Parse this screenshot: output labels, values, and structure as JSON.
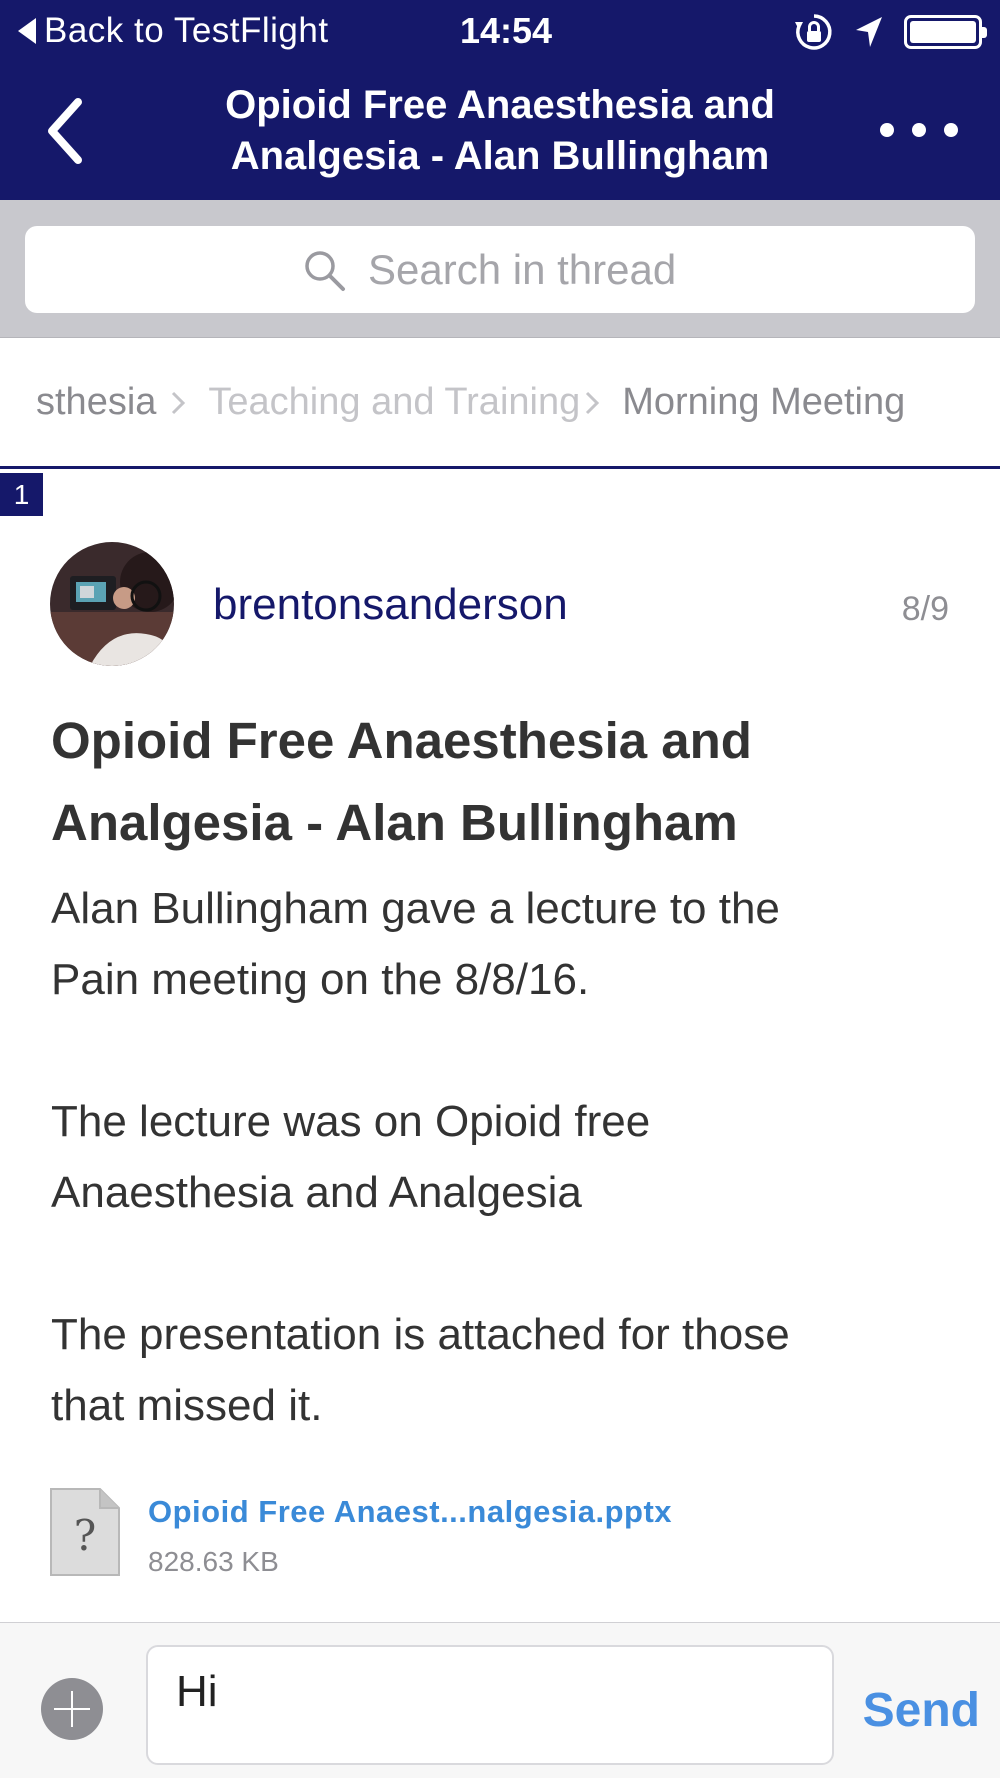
{
  "status_bar": {
    "back_label": "Back to TestFlight",
    "time": "14:54",
    "icons": [
      "rotation-lock-icon",
      "location-arrow-icon",
      "battery-icon"
    ]
  },
  "nav": {
    "back_icon": "chevron-left-icon",
    "title_line1": "Opioid Free Anaesthesia and",
    "title_line2": "Analgesia - Alan Bullingham",
    "more_icon": "more-dots-icon"
  },
  "search": {
    "placeholder": "Search in thread",
    "icon": "search-icon"
  },
  "breadcrumb": {
    "items": [
      "sthesia",
      "Teaching and Training",
      "Morning Meeting"
    ]
  },
  "post": {
    "number": "1",
    "username": "brentonsanderson",
    "date": "8/9",
    "title_line1": "Opioid Free Anaesthesia and",
    "title_line2": "Analgesia - Alan Bullingham",
    "body": {
      "p1_line1": "Alan Bullingham gave a lecture to the",
      "p1_line2": "Pain meeting on the 8/8/16.",
      "p2_line1": "The lecture was on Opioid free",
      "p2_line2": "Anaesthesia and Analgesia",
      "p3_line1": "The presentation is attached for those",
      "p3_line2": "that missed it."
    },
    "attachment": {
      "file_name": "Opioid Free Anaest...nalgesia.pptx",
      "file_size": "828.63 KB",
      "icon": "unknown-file-icon",
      "icon_glyph": "?"
    }
  },
  "composer": {
    "input_value": "Hi",
    "send_label": "Send",
    "plus_icon": "plus-circle-icon"
  },
  "colors": {
    "nav_background": "#15186a",
    "link": "#3a8ad8",
    "send": "#4a90e2",
    "username": "#15186a",
    "search_area": "#c8c8cd"
  }
}
